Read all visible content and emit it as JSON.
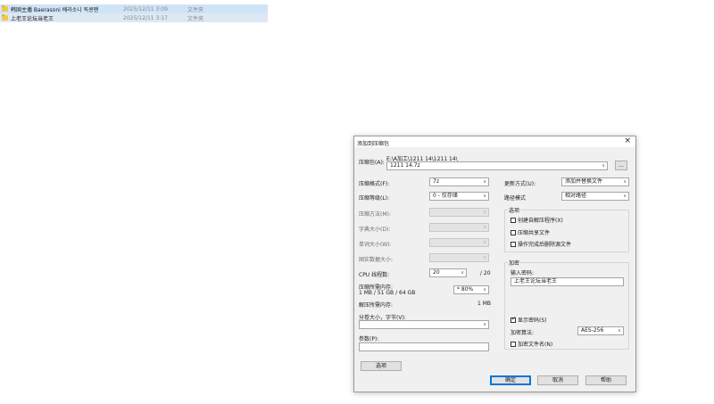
{
  "files": [
    {
      "name": "韩国主播 Baerasoni 배라소니 똑콩펜",
      "date": "2025/12/11 3:09",
      "type": "文件夹"
    },
    {
      "name": "上老王论坛当老王",
      "date": "2025/12/11 3:17",
      "type": "文件夹"
    }
  ],
  "dialog": {
    "title": "添加到压缩包",
    "archive_label": "压缩包(A):",
    "archive_path": "E:\\A加工\\1211 14\\1211 14\\",
    "archive_name": "1211 14.7z",
    "browse_label": "...",
    "format_label": "压缩格式(F):",
    "format_value": "7z",
    "level_label": "压缩等级(L):",
    "level_value": "0 - 仅存储",
    "method_label": "压缩方法(M):",
    "dict_label": "字典大小(D):",
    "word_label": "单词大小(W):",
    "solid_label": "固实数据大小:",
    "cpu_label": "CPU 线程数:",
    "cpu_value": "20",
    "cpu_max": "/ 20",
    "mem_compress_label": "压缩所需内存:",
    "mem_compress_detail": "1 MB / 51 GB / 64 GB",
    "mem_percent": "* 80%",
    "mem_decompress_label": "解压所需内存:",
    "mem_decompress_value": "1 MB",
    "split_label": "分卷大小，字节(V):",
    "params_label": "参数(P):",
    "options_button": "选项",
    "update_label": "更新方式(U):",
    "update_value": "添加并替换文件",
    "pathmode_label": "路径模式",
    "pathmode_value": "相对路径",
    "options_group": "选项",
    "opt_sfx": "创建自解压程序(X)",
    "opt_shared": "压缩共享文件",
    "opt_delete": "操作完成后删除源文件",
    "encrypt_group": "加密",
    "password_label": "输入密码:",
    "password_value": "上老王论坛当老王",
    "show_password": "显示密码(S)",
    "enc_method_label": "加密算法:",
    "enc_method_value": "AES-256",
    "encrypt_names": "加密文件名(N)",
    "ok": "确定",
    "cancel": "取消",
    "help": "帮助"
  }
}
